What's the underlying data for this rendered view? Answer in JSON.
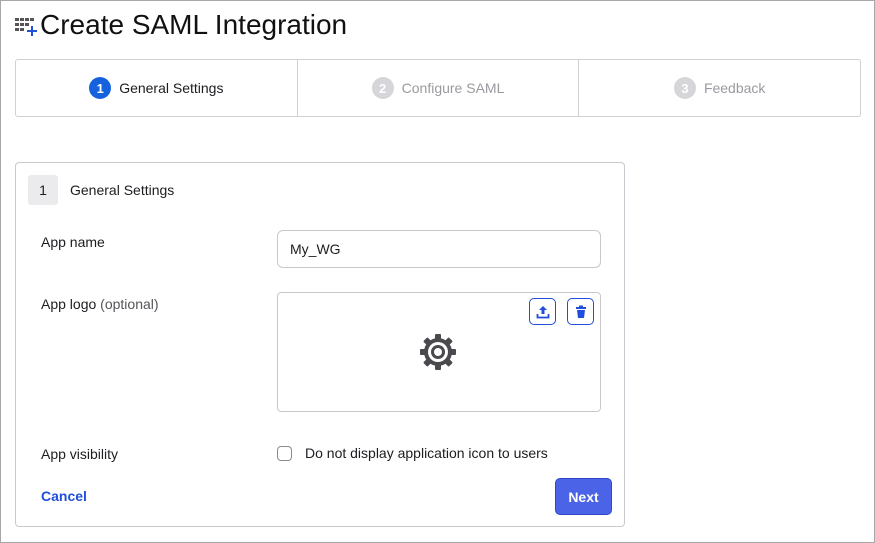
{
  "header": {
    "title": "Create SAML Integration"
  },
  "stepper": [
    {
      "num": "1",
      "label": "General Settings"
    },
    {
      "num": "2",
      "label": "Configure SAML"
    },
    {
      "num": "3",
      "label": "Feedback"
    }
  ],
  "card": {
    "num": "1",
    "title": "General Settings",
    "app_name_label": "App name",
    "app_name_value": "My_WG",
    "app_logo_label": "App logo",
    "app_logo_optional": "(optional)",
    "visibility_label": "App visibility",
    "visibility_checkbox": "Do not display application icon to users",
    "cancel": "Cancel",
    "next": "Next"
  },
  "colors": {
    "accent": "#1662dd",
    "button": "#4a63e7"
  }
}
